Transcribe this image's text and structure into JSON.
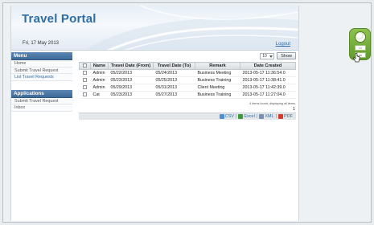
{
  "header": {
    "app_title": "Travel Portal",
    "date": "Fri, 17 May 2013",
    "logout": "Logout"
  },
  "sidebar": {
    "menu_title": "Menu",
    "menu_items": [
      "Home",
      "Submit Travel Request",
      "List Travel Requests"
    ],
    "applications_title": "Applications",
    "app_items": [
      "Submit Travel Request",
      "Inbox"
    ]
  },
  "pager": {
    "per_page": "10",
    "show_label": "Show"
  },
  "table": {
    "columns": [
      "Name",
      "Travel Date (From)",
      "Travel Date (To)",
      "Remark",
      "Date Created"
    ],
    "rows": [
      [
        "Admin",
        "05/22/2013",
        "05/24/2013",
        "Business Meeting",
        "2013-05-17 11:36:54.0"
      ],
      [
        "Admin",
        "05/23/2013",
        "05/25/2013",
        "Business Training",
        "2013-05-17 11:38:41.0"
      ],
      [
        "Admin",
        "05/29/2013",
        "05/31/2013",
        "Client Meeting",
        "2013-05-17 11:42:39.0"
      ],
      [
        "Cat",
        "05/23/2013",
        "05/27/2013",
        "Business Training",
        "2013-05-17 11:27:04.0"
      ]
    ],
    "found_text": "4 items found, displaying all items.",
    "page": "1"
  },
  "export": {
    "csv": "CSV",
    "excel": "Excel",
    "xml": "XML",
    "pdf": "PDF"
  },
  "widget": {
    "tab1": "==",
    "tab2": "on"
  },
  "colors": {
    "accent": "#2e6da4",
    "menu_header": "#3e6a98",
    "widget_green": "#6fa834"
  }
}
